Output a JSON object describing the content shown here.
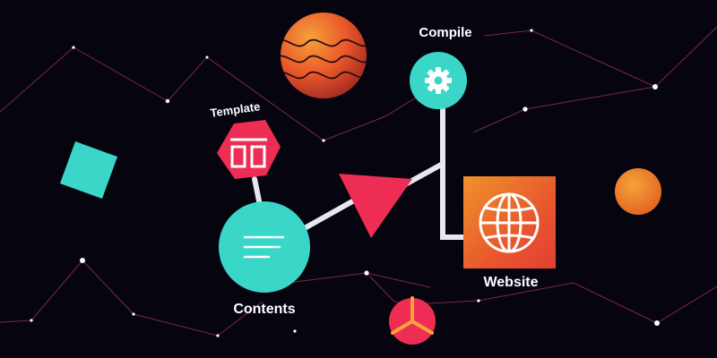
{
  "nodes": {
    "template": {
      "label": "Template",
      "icon": "template-layout-icon"
    },
    "compile": {
      "label": "Compile",
      "icon": "gear-icon"
    },
    "contents": {
      "label": "Contents",
      "icon": "text-lines-icon"
    },
    "website": {
      "label": "Website",
      "icon": "globe-icon"
    }
  },
  "colors": {
    "background": "#06040f",
    "teal": "#3ad6c8",
    "red": "#ee2d55",
    "orange": "#f07a2a",
    "connector": "#e7e7ef",
    "constellation_line": "#7b2849"
  }
}
